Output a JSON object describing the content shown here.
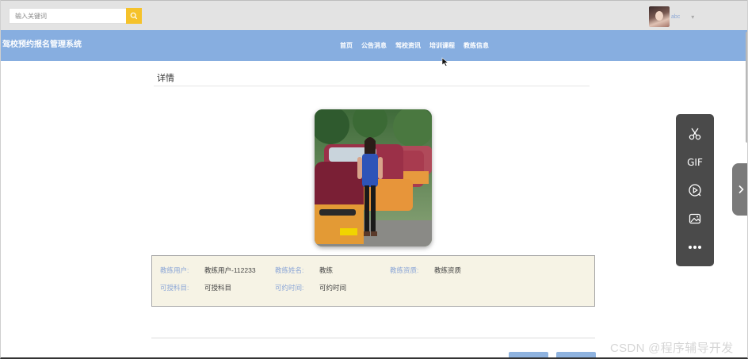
{
  "search": {
    "placeholder": "输入关键词",
    "icon": "search-icon"
  },
  "user": {
    "name": "abc"
  },
  "header": {
    "brand": "驾校预约报名管理系统",
    "nav": [
      "首页",
      "公告消息",
      "驾校资讯",
      "培训课程",
      "教练信息"
    ]
  },
  "detail": {
    "title": "详情",
    "fields": [
      {
        "label": "教练用户:",
        "value": "教练用户-112233"
      },
      {
        "label": "教练姓名:",
        "value": "教练"
      },
      {
        "label": "教练资质:",
        "value": "教练资质"
      },
      {
        "label": "可授科目:",
        "value": "可授科目"
      },
      {
        "label": "可约时间:",
        "value": "可约时间"
      }
    ]
  },
  "toolbar": {
    "gif_label": "GIF"
  },
  "watermark": "CSDN @程序辅导开发",
  "colors": {
    "nav_bg": "#87aee0",
    "search_button": "#f5c22b",
    "label_blue": "#8ba6d7",
    "info_bg": "#f6f3e5"
  }
}
